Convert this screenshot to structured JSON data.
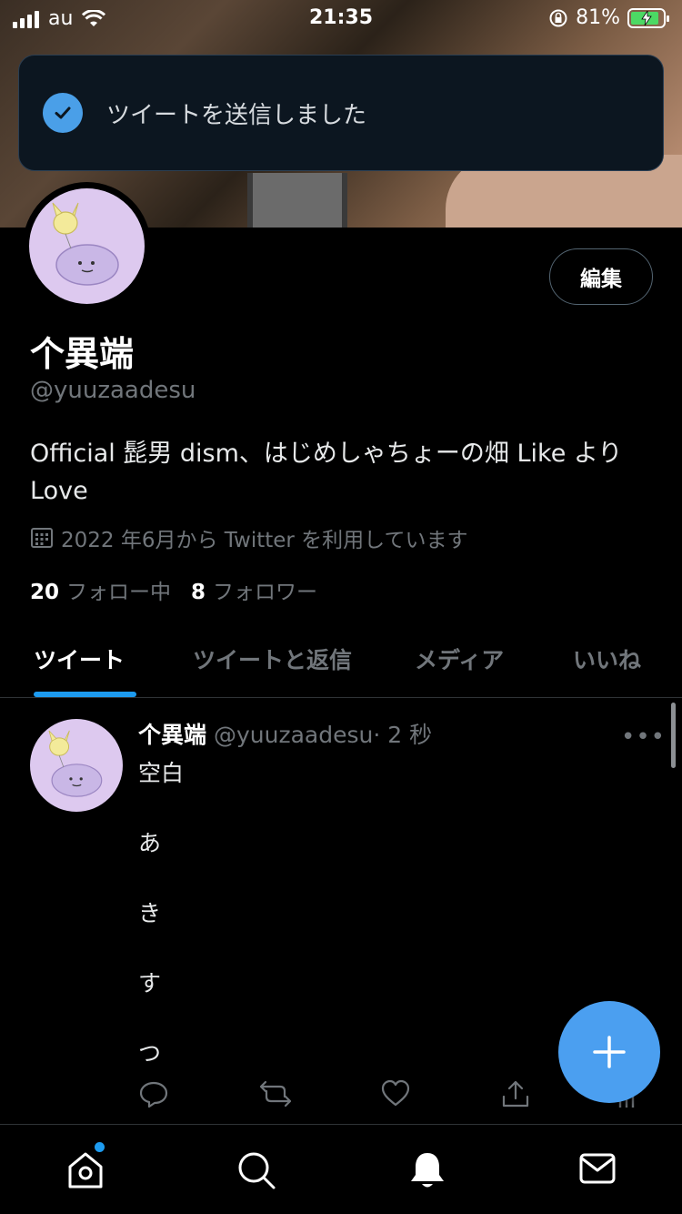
{
  "status_bar": {
    "carrier": "au",
    "time": "21:35",
    "battery": "81%",
    "battery_level": 0.81
  },
  "toast": {
    "message": "ツイートを送信しました"
  },
  "profile": {
    "edit_label": "編集",
    "name": "个異端",
    "handle": "@yuuzaadesu",
    "bio": "Official 髭男 dism、はじめしゃちょーの畑 Like より Love",
    "joined": "2022 年6月から Twitter を利用しています",
    "following_count": "20",
    "following_label": "フォロー中",
    "followers_count": "8",
    "followers_label": "フォロワー"
  },
  "tabs": [
    {
      "label": "ツイート",
      "active": true
    },
    {
      "label": "ツイートと返信",
      "active": false
    },
    {
      "label": "メディア",
      "active": false
    },
    {
      "label": "いいね",
      "active": false
    }
  ],
  "tweet": {
    "name": "个異端",
    "handle": "@yuuzaadesu",
    "time": "· 2 秒",
    "lines": [
      "空白",
      "あ",
      "き",
      "す",
      "つ"
    ]
  },
  "colors": {
    "accent": "#1d9bf0",
    "fab": "#4b9ff0",
    "toast_bg": "#0c1620",
    "muted": "#71767b"
  },
  "icons": {
    "toast": "check-circle-icon",
    "joined": "calendar-icon",
    "actions": [
      "reply-icon",
      "retweet-icon",
      "like-icon",
      "share-icon",
      "analytics-icon"
    ],
    "nav": [
      "home-icon",
      "search-icon",
      "notifications-icon",
      "messages-icon"
    ],
    "fab": "plus-icon"
  }
}
